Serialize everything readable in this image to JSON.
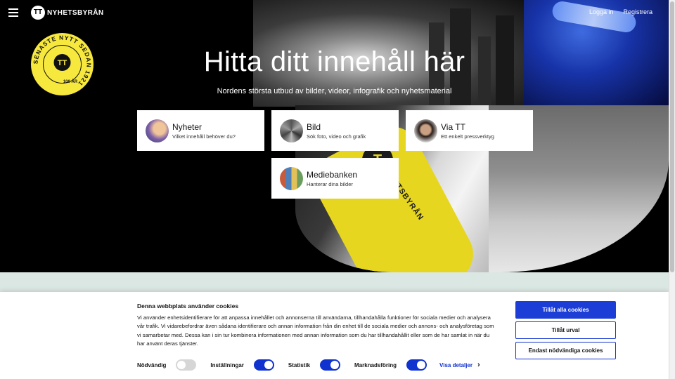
{
  "header": {
    "logo_text": "NYHETSBYRÅN",
    "logo_mark": "TT",
    "login": "Logga in",
    "register": "Registrera"
  },
  "badge": {
    "ring_text": "SENASTE NYTT SEDAN 1921",
    "center": "TT",
    "years": "100 ÅR"
  },
  "hero": {
    "title": "Hitta ditt innehåll här",
    "subtitle": "Nordens största utbud av bilder, videor, infografik och nyhetsmaterial"
  },
  "cards": [
    {
      "title": "Nyheter",
      "subtitle": "Vilket innehåll behöver du?"
    },
    {
      "title": "Bild",
      "subtitle": "Sök foto, video och grafik"
    },
    {
      "title": "Via TT",
      "subtitle": "Ett enkelt pressverktyg"
    },
    {
      "title": "Mediebanken",
      "subtitle": "Hanterar dina bilder"
    }
  ],
  "mic_label": "NYHETSBYRÅN",
  "cookie": {
    "title": "Denna webbplats använder cookies",
    "text": "Vi använder enhetsidentifierare för att anpassa innehållet och annonserna till användarna, tillhandahålla funktioner för sociala medier och analysera vår trafik. Vi vidarebefordrar även sådana identifierare och annan information från din enhet till de sociala medier och annons- och analysföretag som vi samarbetar med. Dessa kan i sin tur kombinera informationen med annan information som du har tillhandahållit eller som de har samlat in när du har använt deras tjänster.",
    "toggles": [
      {
        "label": "Nödvändig",
        "on": true,
        "disabled": true
      },
      {
        "label": "Inställningar",
        "on": true
      },
      {
        "label": "Statistik",
        "on": true
      },
      {
        "label": "Marknadsföring",
        "on": true
      }
    ],
    "details": "Visa detaljer",
    "allow_all": "Tillåt alla cookies",
    "allow_selection": "Tillåt urval",
    "only_necessary": "Endast nödvändiga cookies"
  },
  "colors": {
    "accent": "#1d3ed6",
    "badge_yellow": "#f7e83e",
    "band": "#dbe7e2"
  }
}
